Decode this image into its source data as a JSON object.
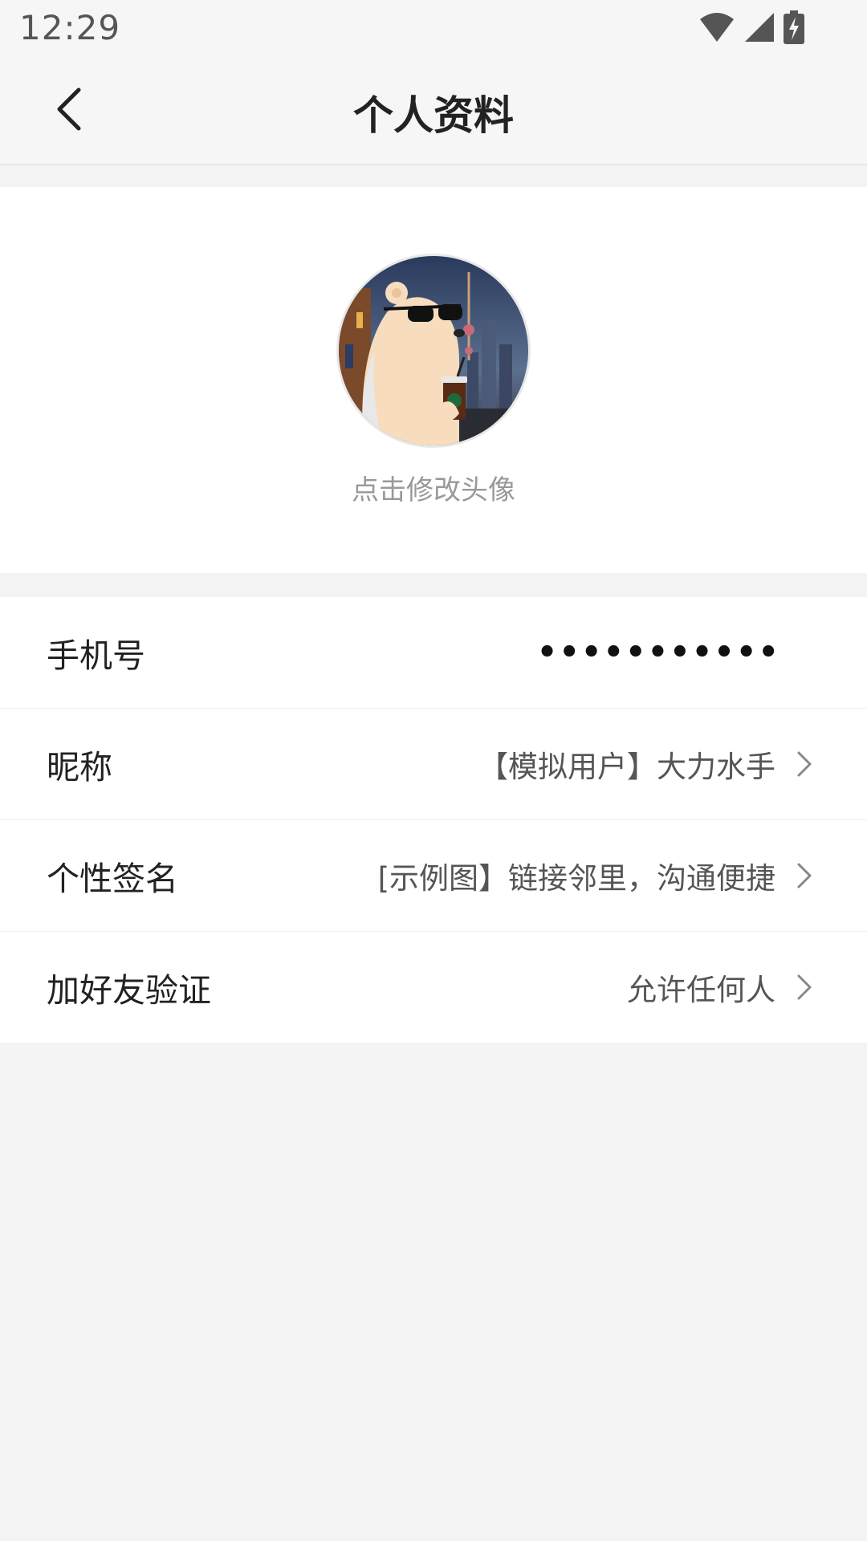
{
  "status_bar": {
    "time": "12:29",
    "icons": [
      "wifi-icon",
      "signal-icon",
      "battery-charging-icon"
    ]
  },
  "header": {
    "title": "个人资料",
    "back_icon": "chevron-left-icon"
  },
  "avatar": {
    "caption": "点击修改头像",
    "image": "avatar-bear-sunglasses"
  },
  "profile_items": [
    {
      "label": "手机号",
      "value": "•••••••••••",
      "has_chevron": false
    },
    {
      "label": "昵称",
      "value": "【模拟用户】大力水手",
      "has_chevron": true
    },
    {
      "label": "个性签名",
      "value": "[示例图】链接邻里，沟通便捷",
      "has_chevron": true
    },
    {
      "label": "加好友验证",
      "value": "允许任何人",
      "has_chevron": true
    }
  ],
  "colors": {
    "background": "#f4f4f4",
    "card": "#ffffff",
    "title_text": "#222222",
    "secondary_text": "#999999"
  }
}
